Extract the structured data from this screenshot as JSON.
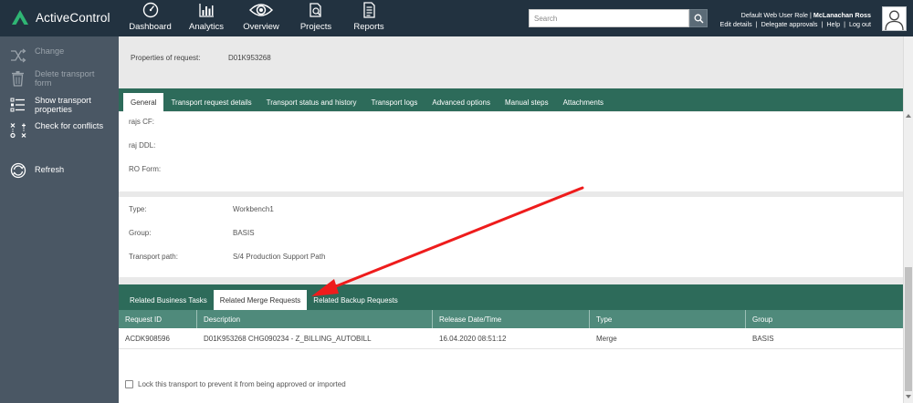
{
  "app": {
    "name": "ActiveControl"
  },
  "nav": [
    {
      "label": "Dashboard",
      "icon": "dashboard-gauge-icon"
    },
    {
      "label": "Analytics",
      "icon": "bar-chart-icon"
    },
    {
      "label": "Overview",
      "icon": "eye-icon"
    },
    {
      "label": "Projects",
      "icon": "projects-icon"
    },
    {
      "label": "Reports",
      "icon": "document-icon"
    }
  ],
  "search": {
    "placeholder": "Search"
  },
  "user": {
    "role": "Default Web User Role",
    "separator": " | ",
    "name": "McLanachan Ross",
    "links": [
      "Edit details",
      "Delegate approvals",
      "Help",
      "Log out"
    ]
  },
  "sidebar": {
    "items": [
      {
        "label": "Change",
        "icon": "shuffle-icon",
        "enabled": false
      },
      {
        "label": "Delete transport form",
        "icon": "trash-icon",
        "enabled": false
      },
      {
        "label": "Show transport properties",
        "icon": "list-icon",
        "enabled": true
      },
      {
        "label": "Check for conflicts",
        "icon": "conflicts-icon",
        "enabled": true
      },
      {
        "label": "Refresh",
        "icon": "refresh-icon",
        "enabled": true
      }
    ]
  },
  "props": {
    "label": "Properties of request:",
    "value": "D01K953268"
  },
  "tabs": [
    "General",
    "Transport request details",
    "Transport status and history",
    "Transport logs",
    "Advanced options",
    "Manual steps",
    "Attachments"
  ],
  "active_tab": "General",
  "custom_fields": [
    {
      "label": "rajs CF:",
      "value": ""
    },
    {
      "label": "raj DDL:",
      "value": ""
    },
    {
      "label": "RO Form:",
      "value": ""
    }
  ],
  "details": [
    {
      "label": "Type:",
      "value": "Workbench1"
    },
    {
      "label": "Group:",
      "value": "BASIS"
    },
    {
      "label": "Transport path:",
      "value": "S/4 Production Support Path"
    }
  ],
  "related_tabs": [
    "Related Business Tasks",
    "Related Merge Requests",
    "Related Backup Requests"
  ],
  "active_related_tab": "Related Merge Requests",
  "table": {
    "columns": [
      "Request ID",
      "Description",
      "Release Date/Time",
      "Type",
      "Group"
    ],
    "rows": [
      [
        "ACDK908596",
        "D01K953268 CHG090234 - Z_BILLING_AUTOBILL",
        "16.04.2020 08:51:12",
        "Merge",
        "BASIS"
      ]
    ]
  },
  "lock": {
    "label": "Lock this transport to prevent it from being approved or imported",
    "checked": false
  },
  "colors": {
    "topbar": "#223240",
    "sidebar": "#4a5764",
    "tabbar": "#2d6b5a",
    "table_header": "#4f8a7b",
    "logo_green": "#2fb574",
    "annotation_arrow": "#ee1c1c"
  }
}
